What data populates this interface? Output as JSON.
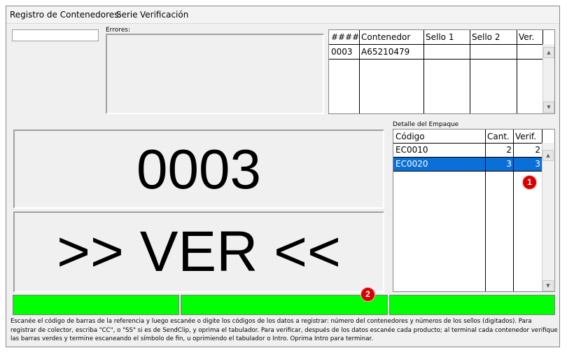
{
  "menu": [
    "Registro de Contenedores:",
    "Serie",
    "Verificación"
  ],
  "errors_label": "Errores:",
  "containers_table": {
    "headers": [
      "####",
      "Contenedor",
      "Sello 1",
      "Sello 2",
      "Ver."
    ],
    "rows": [
      [
        "0003",
        "A65210479",
        "",
        "",
        ""
      ]
    ]
  },
  "detail_label": "Detalle del Empaque",
  "detail_table": {
    "headers": [
      "Código",
      "Cant.",
      "Verif."
    ],
    "rows": [
      [
        "EC0010",
        "2",
        "2"
      ],
      [
        "EC0020",
        "3",
        "3"
      ]
    ],
    "selected_row": 1
  },
  "display": {
    "number": "0003",
    "status": ">> VER <<"
  },
  "status_colors": {
    "bar": "#00ff00",
    "selection": "#0a6fd6",
    "badge": "#d90000"
  },
  "badges": [
    "1",
    "2"
  ],
  "instructions": "Escanée el código de barras de la referencia y luego escanée o digite los códigos de los datos a registrar: número del contenedores y números de los sellos (digitados). Para registrar de colector, escriba \"CC\", o \"SS\" si es de SendClip, y oprima el tabulador. Para verificar, después de los datos escanée cada producto; al terminal cada contenedor verifique las barras verdes y termine escaneando el símbolo de fin, u oprimiendo el tabulador o Intro. Oprima Intro para terminar."
}
